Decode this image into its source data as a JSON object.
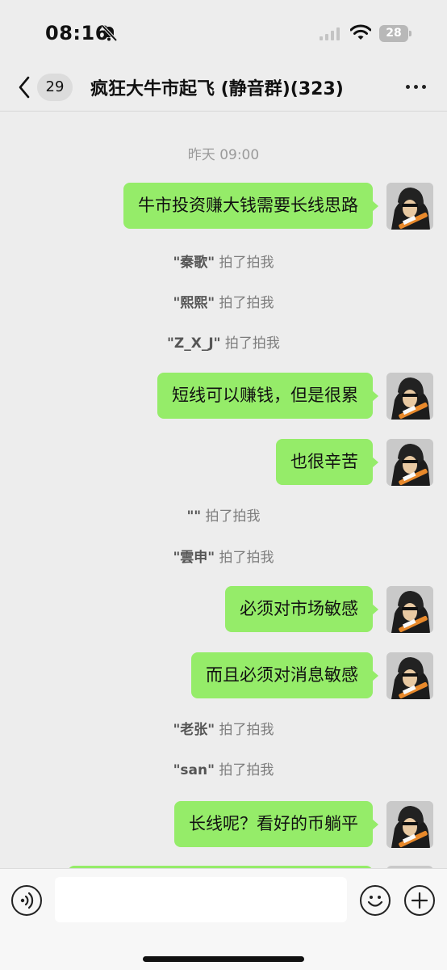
{
  "status_bar": {
    "time": "08:16",
    "battery": "28"
  },
  "header": {
    "unread_count": "29",
    "title": "疯狂大牛市起飞 (静音群)(323)"
  },
  "chat": {
    "timestamp": "昨天 09:00",
    "messages": [
      {
        "type": "text",
        "text": "牛市投资赚大钱需要长线思路"
      },
      {
        "type": "pat",
        "name": "\"秦歌\"",
        "action": " 拍了拍我"
      },
      {
        "type": "pat",
        "name": "\"熙熙\"",
        "action": " 拍了拍我"
      },
      {
        "type": "pat",
        "name": "\"Z_X_J\"",
        "action": " 拍了拍我"
      },
      {
        "type": "text",
        "text": "短线可以赚钱，但是很累"
      },
      {
        "type": "text",
        "text": "也很辛苦"
      },
      {
        "type": "pat",
        "name": "\"\"",
        "action": " 拍了拍我"
      },
      {
        "type": "pat",
        "name": "\"雲申\"",
        "action": " 拍了拍我"
      },
      {
        "type": "text",
        "text": "必须对市场敏感"
      },
      {
        "type": "text",
        "text": "而且必须对消息敏感"
      },
      {
        "type": "pat",
        "name": "\"老张\"",
        "action": " 拍了拍我"
      },
      {
        "type": "pat",
        "name": "\"san\"",
        "action": " 拍了拍我"
      },
      {
        "type": "text",
        "text": "长线呢？看好的币躺平"
      }
    ]
  },
  "input_bar": {
    "value": ""
  },
  "colors": {
    "bubble": "#95ec69",
    "background": "#ededed"
  },
  "icons": [
    "bell-muted-icon",
    "signal-icon",
    "wifi-icon",
    "back-chevron-icon",
    "more-icon",
    "voice-icon",
    "emoji-icon",
    "plus-icon"
  ]
}
